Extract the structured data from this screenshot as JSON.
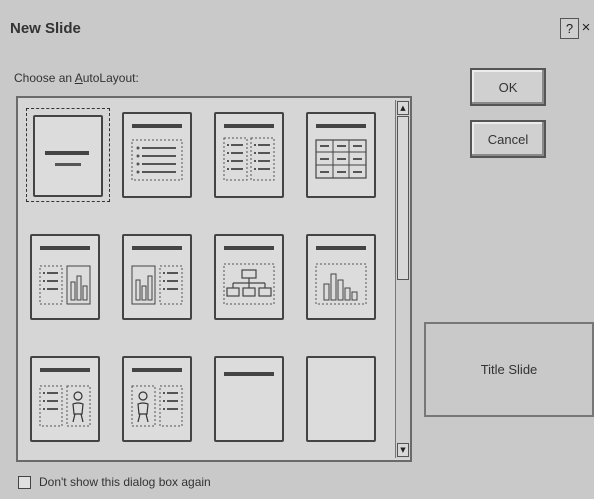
{
  "dialog": {
    "title": "New Slide",
    "help_label": "?",
    "close_label": "×"
  },
  "chooser": {
    "label_prefix": "Choose an ",
    "label_accel": "A",
    "label_suffix": "utoLayout:",
    "layouts": [
      {
        "icon": "title-slide-layout-icon",
        "selected": true
      },
      {
        "icon": "bulleted-list-layout-icon",
        "selected": false
      },
      {
        "icon": "two-column-text-layout-icon",
        "selected": false
      },
      {
        "icon": "table-layout-icon",
        "selected": false
      },
      {
        "icon": "text-and-chart-layout-icon",
        "selected": false
      },
      {
        "icon": "chart-and-text-layout-icon",
        "selected": false
      },
      {
        "icon": "organization-chart-layout-icon",
        "selected": false
      },
      {
        "icon": "chart-layout-icon",
        "selected": false
      },
      {
        "icon": "text-and-clip-art-layout-icon",
        "selected": false
      },
      {
        "icon": "clip-art-and-text-layout-icon",
        "selected": false
      },
      {
        "icon": "title-only-layout-icon",
        "selected": false
      },
      {
        "icon": "blank-layout-icon",
        "selected": false
      }
    ]
  },
  "buttons": {
    "ok_label": "OK",
    "cancel_label": "Cancel"
  },
  "preview": {
    "caption": "Title Slide"
  },
  "footer": {
    "checkbox_label": "Don't show this dialog box again",
    "checked": false
  }
}
